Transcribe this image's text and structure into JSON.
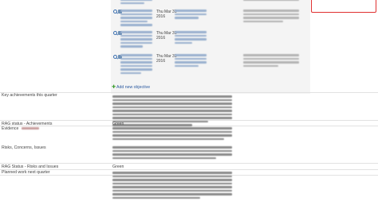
{
  "objectives": [
    {
      "date_line1": "Thu Mar 31",
      "date_line2": "2016"
    },
    {
      "date_line1": "Thu Mar 31",
      "date_line2": "2016"
    },
    {
      "date_line1": "Thu Mar 31",
      "date_line2": "2016"
    }
  ],
  "add_objective_label": "Add new objective",
  "rows": {
    "key_achievements": {
      "label": "Key achievements this quarter"
    },
    "rag_achievements": {
      "label": "RAG status - Achievements",
      "value": "Green"
    },
    "evidence": {
      "label": "Evidence"
    },
    "risks": {
      "label": "Risks, Concerns, Issues"
    },
    "rag_risks": {
      "label": "RAG Status - Risks and Issues",
      "value": "Green"
    },
    "planned_work": {
      "label": "Planned work next quarter"
    }
  },
  "colors": {
    "link": "#2c5aa0",
    "add_icon": "#3b9b2d",
    "highlight_border": "#e03030"
  }
}
